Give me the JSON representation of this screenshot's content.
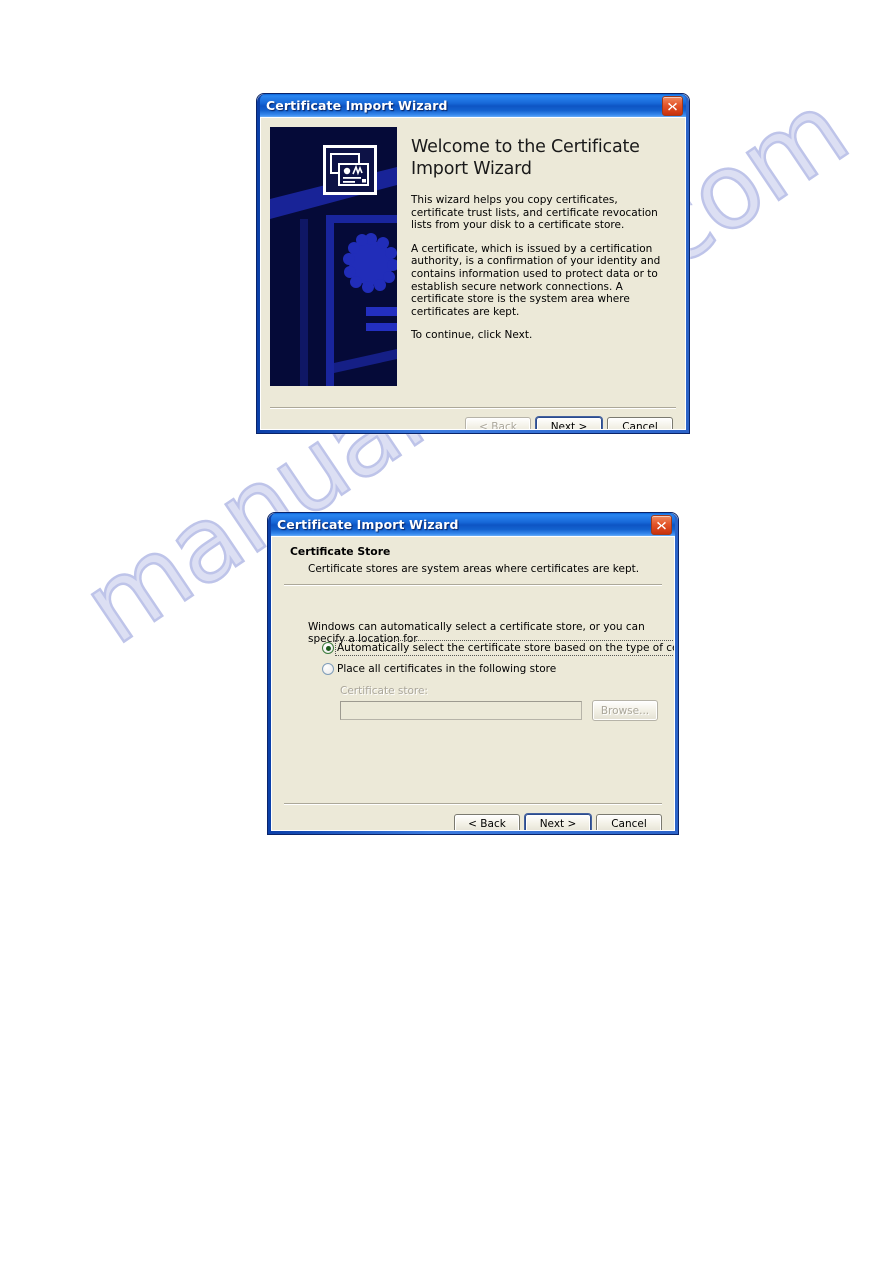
{
  "page": {
    "watermark": "manualshive.com",
    "background": "#ffffff",
    "accent_title_blue": "#1768d8",
    "dialog_face": "#ece9d8",
    "banner_navy": "#050a38",
    "close_red": "#e4562a"
  },
  "dialog_welcome": {
    "title": "Certificate Import Wizard",
    "close_icon": "close-icon",
    "banner_icon": "certificate-icon",
    "heading": "Welcome to the Certificate Import Wizard",
    "paragraphs": [
      "This wizard helps you copy certificates, certificate trust lists, and certificate revocation lists from your disk to a certificate store.",
      "A certificate, which is issued by a certification authority, is a confirmation of your identity and contains information used to protect data or to establish secure network connections. A certificate store is the system area where certificates are kept.",
      "To continue, click Next."
    ],
    "buttons": {
      "back": {
        "label": "< Back",
        "accel": "B",
        "enabled": false,
        "default": false
      },
      "next": {
        "label": "Next >",
        "accel": "N",
        "enabled": true,
        "default": true
      },
      "cancel": {
        "label": "Cancel",
        "accel": "",
        "enabled": true,
        "default": false
      }
    }
  },
  "dialog_store": {
    "title": "Certificate Import Wizard",
    "close_icon": "close-icon",
    "header_title": "Certificate Store",
    "header_subtitle": "Certificate stores are system areas where certificates are kept.",
    "intro_text": "Windows can automatically select a certificate store, or you can specify a location for",
    "options": [
      {
        "label": "Automatically select the certificate store based on the type of certificate",
        "accel": "u",
        "selected": true,
        "focused": true
      },
      {
        "label": "Place all certificates in the following store",
        "accel": "P",
        "selected": false,
        "focused": false
      }
    ],
    "store_field": {
      "label": "Certificate store:",
      "value": "",
      "placeholder": "",
      "enabled": false
    },
    "browse_button": {
      "label": "Browse...",
      "accel": "r",
      "enabled": false
    },
    "buttons": {
      "back": {
        "label": "< Back",
        "accel": "B",
        "enabled": true,
        "default": false
      },
      "next": {
        "label": "Next >",
        "accel": "N",
        "enabled": true,
        "default": true
      },
      "cancel": {
        "label": "Cancel",
        "accel": "",
        "enabled": true,
        "default": false
      }
    }
  }
}
